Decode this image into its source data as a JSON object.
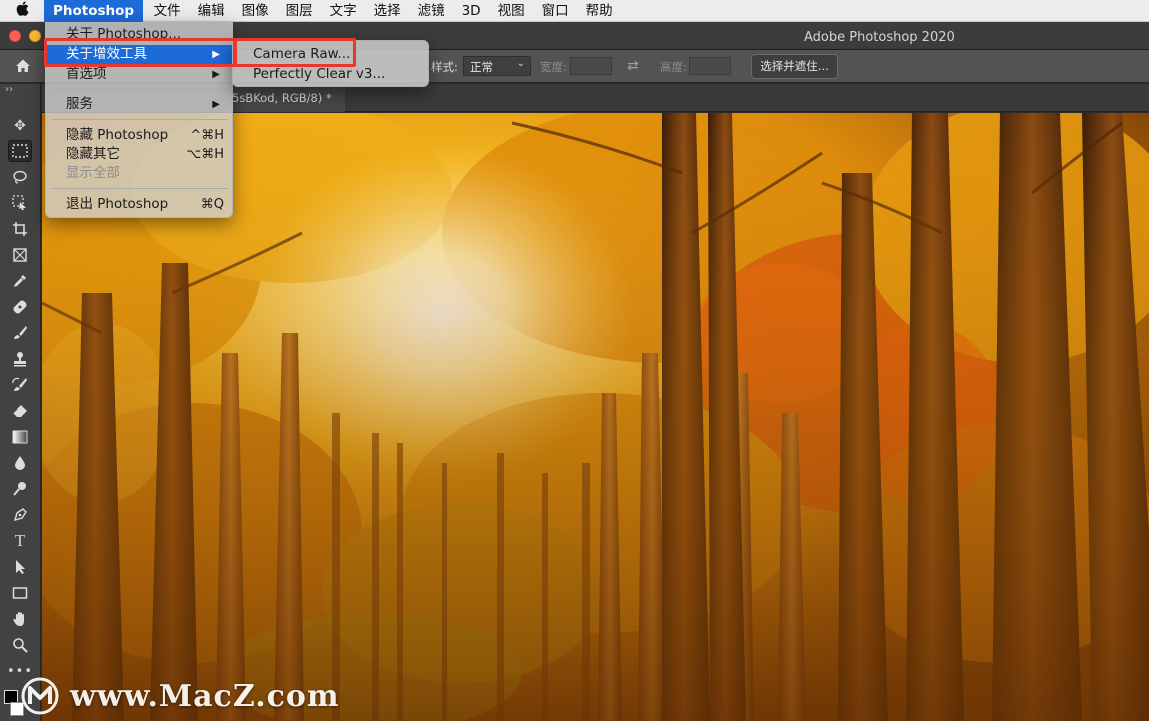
{
  "menubar": {
    "apple_icon": "apple-icon",
    "app_name": "Photoshop",
    "items": [
      "文件",
      "编辑",
      "图像",
      "图层",
      "文字",
      "选择",
      "滤镜",
      "3D",
      "视图",
      "窗口",
      "帮助"
    ]
  },
  "window": {
    "title": "Adobe Photoshop 2020"
  },
  "app_menu": {
    "items": [
      {
        "label": "关于 Photoshop..."
      },
      {
        "label": "关于增效工具",
        "arrow": "▶",
        "highlighted": true
      },
      {
        "label": "首选项",
        "arrow": "▶"
      },
      {
        "label": "服务",
        "arrow": "▶"
      },
      {
        "label": "隐藏 Photoshop",
        "shortcut": "^⌘H"
      },
      {
        "label": "隐藏其它",
        "shortcut": "⌥⌘H"
      },
      {
        "label": "显示全部",
        "disabled": true
      },
      {
        "label": "退出 Photoshop",
        "shortcut": "⌘Q"
      }
    ]
  },
  "plugin_submenu": {
    "items": [
      {
        "label": "Camera Raw..."
      },
      {
        "label": "Perfectly Clear v3..."
      }
    ]
  },
  "options_bar": {
    "style_label": "样式:",
    "style_value": "正常",
    "width_label": "宽度:",
    "height_label": "高度:",
    "select_mask_label": "选择并遮住..."
  },
  "document": {
    "tab_label": "5sBKod, RGB/8) *"
  },
  "toolbar": {
    "collapse_label": "››",
    "tools": [
      "move-tool",
      "marquee-tool",
      "lasso-tool",
      "object-select-tool",
      "crop-tool",
      "frame-tool",
      "eyedropper-tool",
      "healing-tool",
      "brush-tool",
      "stamp-tool",
      "history-brush-tool",
      "eraser-tool",
      "gradient-tool",
      "blur-tool",
      "dodge-tool",
      "pen-tool",
      "type-tool",
      "path-select-tool",
      "rectangle-tool",
      "hand-tool",
      "zoom-tool",
      "more-tools"
    ]
  },
  "watermark": {
    "text": "www.MacZ.com"
  },
  "colors": {
    "highlight": "#1d6ad9",
    "annotation_red": "#e6382b",
    "foliage": "#e8a10e"
  }
}
